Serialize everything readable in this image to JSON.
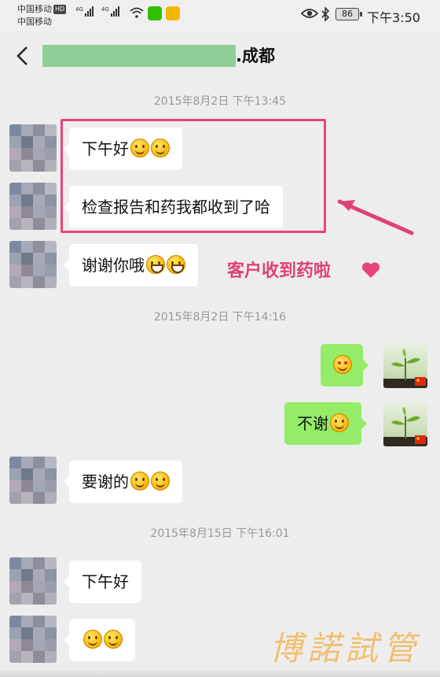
{
  "status_bar": {
    "carrier1": "中国移动",
    "hd_badge": "HD",
    "net1": "4G",
    "net2": "4G",
    "carrier2": "中国移动",
    "battery": "86",
    "time": "下午3:50"
  },
  "nav": {
    "title_suffix": ".成都",
    "back_icon": "chevron-left-icon"
  },
  "messages": [
    {
      "type": "timestamp",
      "text": "2015年8月2日 下午13:45"
    },
    {
      "side": "left",
      "text": "下午好",
      "emojis": [
        "smile",
        "smile"
      ]
    },
    {
      "side": "left",
      "text": "检查报告和药我都收到了哈",
      "emojis": []
    },
    {
      "side": "left",
      "text": "谢谢你哦",
      "emojis": [
        "grin",
        "grin"
      ]
    },
    {
      "type": "timestamp",
      "text": "2015年8月2日 下午14:16"
    },
    {
      "side": "right",
      "text": "",
      "emojis": [
        "love"
      ]
    },
    {
      "side": "right",
      "text": "不谢",
      "emojis": [
        "smile"
      ]
    },
    {
      "side": "left",
      "text": "要谢的",
      "emojis": [
        "smile",
        "smile"
      ]
    },
    {
      "type": "timestamp",
      "text": "2015年8月15日 下午16:01"
    },
    {
      "side": "left",
      "text": "下午好",
      "emojis": []
    },
    {
      "side": "left",
      "text": "",
      "emojis": [
        "smile",
        "smile"
      ]
    }
  ],
  "annotation": {
    "note": "客户收到药啦",
    "color": "#e0407a"
  },
  "watermark": "博諾試管",
  "colors": {
    "bubble_left": "#ffffff",
    "bubble_right": "#95ec69",
    "background": "#ededed",
    "highlight_box": "#e8447a"
  }
}
